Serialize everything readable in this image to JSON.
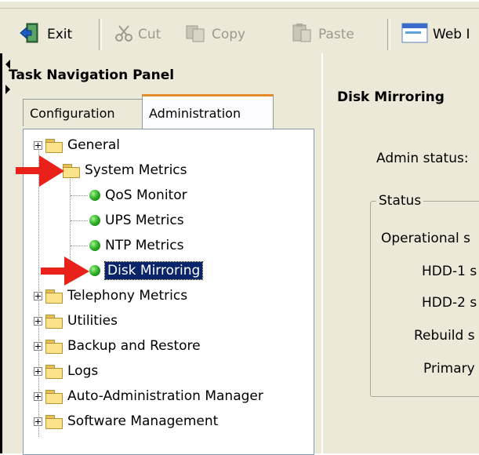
{
  "toolbar": {
    "exit": "Exit",
    "cut": "Cut",
    "copy": "Copy",
    "paste": "Paste",
    "web": "Web I"
  },
  "nav": {
    "title": "Task Navigation Panel",
    "tabs": [
      "Configuration",
      "Administration"
    ],
    "tree": [
      {
        "label": "General",
        "type": "folder",
        "expander": true
      },
      {
        "label": "System Metrics",
        "type": "folder",
        "expander": false
      },
      {
        "label": "QoS Monitor",
        "type": "leaf"
      },
      {
        "label": "UPS Metrics",
        "type": "leaf"
      },
      {
        "label": "NTP Metrics",
        "type": "leaf"
      },
      {
        "label": "Disk Mirroring",
        "type": "leaf",
        "selected": true
      },
      {
        "label": "Telephony Metrics",
        "type": "folder",
        "expander": true
      },
      {
        "label": "Utilities",
        "type": "folder",
        "expander": true
      },
      {
        "label": "Backup and Restore",
        "type": "folder",
        "expander": true
      },
      {
        "label": "Logs",
        "type": "folder",
        "expander": true
      },
      {
        "label": "Auto-Administration Manager",
        "type": "folder",
        "expander": true
      },
      {
        "label": "Software Management",
        "type": "folder",
        "expander": true
      }
    ]
  },
  "detail": {
    "title": "Disk Mirroring",
    "admin_status": "Admin status:",
    "status_group": "Status",
    "fields": [
      "Operational s",
      "HDD-1 s",
      "HDD-2 s",
      "Rebuild s",
      "Primary"
    ]
  },
  "colors": {
    "selection": "#0a246a",
    "arrow": "#e8221b",
    "tab_accent": "#e68b2c"
  }
}
